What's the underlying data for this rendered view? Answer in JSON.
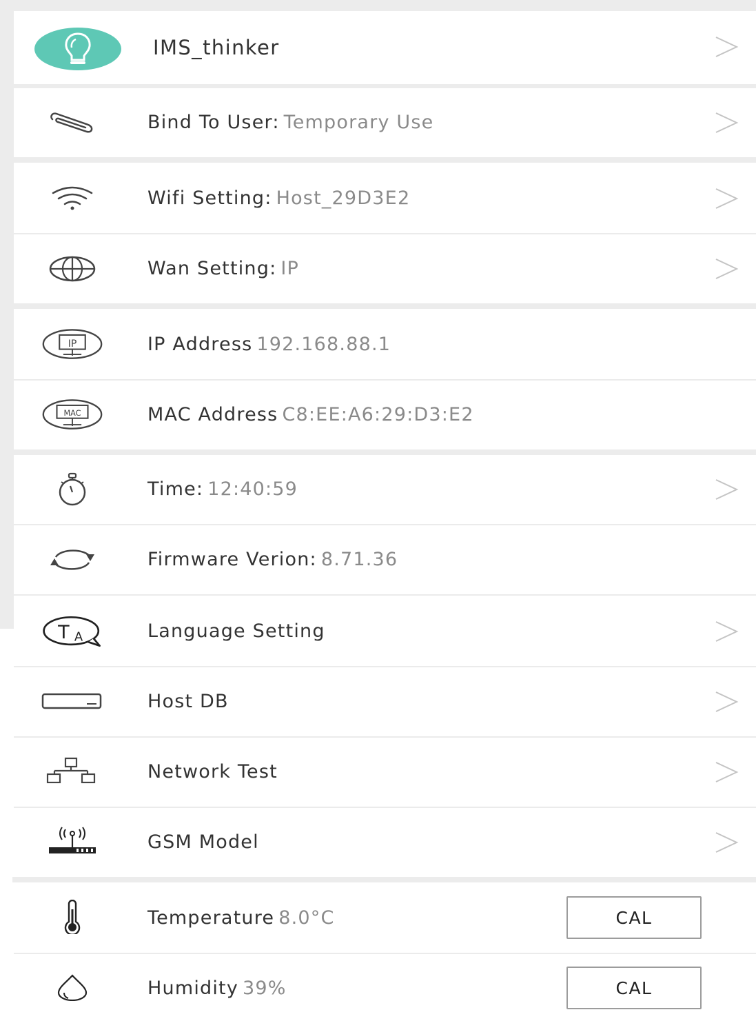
{
  "device": {
    "name": "IMS_thinker"
  },
  "rows": {
    "bind": {
      "key": "Bind To User:",
      "value": "Temporary Use"
    },
    "wifi": {
      "key": "Wifi Setting:",
      "value": "Host_29D3E2"
    },
    "wan": {
      "key": "Wan Setting:",
      "value": "IP"
    },
    "ip": {
      "key": "IP Address",
      "value": "192.168.88.1"
    },
    "mac": {
      "key": "MAC Address",
      "value": "C8:EE:A6:29:D3:E2"
    },
    "time": {
      "key": "Time:",
      "value": "12:40:59"
    },
    "firmware": {
      "key": "Firmware Verion:",
      "value": "8.71.36"
    },
    "language": {
      "key": "Language Setting"
    },
    "hostdb": {
      "key": "Host DB"
    },
    "network": {
      "key": "Network Test"
    },
    "gsm": {
      "key": "GSM Model"
    },
    "temperature": {
      "key": "Temperature",
      "value": "8.0°C",
      "button": "CAL"
    },
    "humidity": {
      "key": "Humidity",
      "value": "39%",
      "button": "CAL"
    }
  },
  "icons": {
    "avatar": "lightbulb-icon",
    "bind": "paperclip-icon",
    "wifi": "wifi-icon",
    "wan": "globe-icon",
    "ip": "ip-address-icon",
    "mac": "mac-address-icon",
    "time": "stopwatch-icon",
    "firmware": "refresh-icon",
    "language": "language-icon",
    "hostdb": "host-device-icon",
    "network": "network-topology-icon",
    "gsm": "gsm-antenna-icon",
    "temperature": "thermometer-icon",
    "humidity": "water-drop-icon",
    "chevron": "chevron-right-icon"
  },
  "colors": {
    "accent": "#5ec8b5",
    "text": "#333333",
    "value": "#8a8a8a",
    "background": "#ececec"
  }
}
